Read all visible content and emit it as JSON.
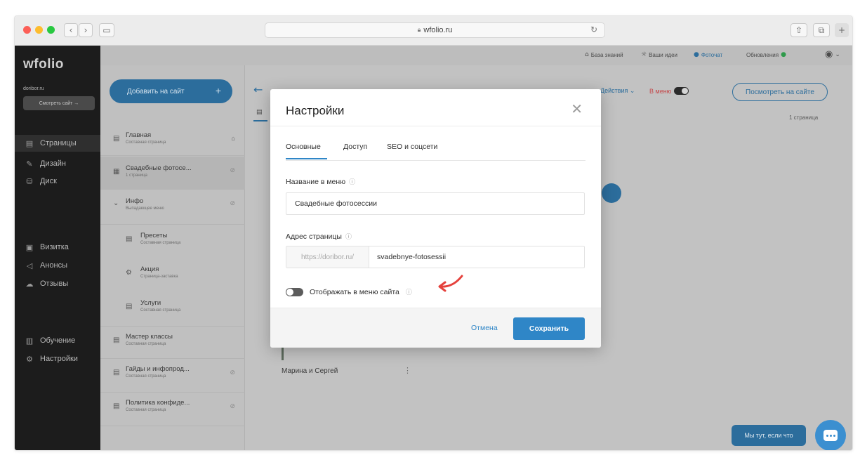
{
  "browser": {
    "url": "wfolio.ru",
    "colors": {
      "close": "#fc5f57",
      "minimize": "#fdbc2e",
      "maximize": "#28c840"
    }
  },
  "app": {
    "logo": "wfolio",
    "site_name": "doribor.ru",
    "visit_site_label": "Смотреть сайт →",
    "sidebar": [
      {
        "label": "Страницы",
        "icon": "page-icon"
      },
      {
        "label": "Дизайн",
        "icon": "brush-icon"
      },
      {
        "label": "Диск",
        "icon": "disk-icon"
      },
      {
        "label": "Визитка",
        "icon": "card-icon"
      },
      {
        "label": "Анонсы",
        "icon": "megaphone-icon"
      },
      {
        "label": "Отзывы",
        "icon": "chat-icon"
      },
      {
        "label": "Обучение",
        "icon": "book-icon"
      },
      {
        "label": "Настройки",
        "icon": "gear-icon"
      }
    ],
    "topbar": {
      "knowledge": "База знаний",
      "ideas": "Ваши идеи",
      "photochat": "Фоточат",
      "updates": "Обновления"
    },
    "add_to_site": "Добавить на сайт",
    "pages": [
      {
        "title": "Главная",
        "subtitle": "Составная страница"
      },
      {
        "title": "Свадебные фотосе...",
        "subtitle": "1 страница"
      },
      {
        "title": "Инфо",
        "subtitle": "Выпадающее меню"
      },
      {
        "title": "Пресеты",
        "subtitle": "Составная страница"
      },
      {
        "title": "Акция",
        "subtitle": "Страница-заставка"
      },
      {
        "title": "Услуги",
        "subtitle": "Составная страница"
      },
      {
        "title": "Мастер классы",
        "subtitle": "Составная страница"
      },
      {
        "title": "Гайды и инфопрод...",
        "subtitle": "Составная страница"
      },
      {
        "title": "Политика конфиде...",
        "subtitle": "Составная страница"
      }
    ],
    "content": {
      "actions_label": "Действия ⌄",
      "in_menu_label": "В меню",
      "view_site_label": "Посмотреть на сайте",
      "pages_count": "1 страница",
      "card_name": "Марина и Сергей"
    },
    "chat": {
      "label": "Мы тут, если что"
    }
  },
  "modal": {
    "title": "Настройки",
    "tabs": [
      "Основные",
      "Доступ",
      "SEO и соцсети"
    ],
    "active_tab": "Основные",
    "menu_name_label": "Название в меню",
    "menu_name_value": "Свадебные фотосессии",
    "address_label": "Адрес страницы",
    "address_prefix": "https://doribor.ru/",
    "address_slug": "svadebnye-fotosessii",
    "show_in_menu_label": "Отображать в меню сайта",
    "show_in_menu": false,
    "cancel_label": "Отмена",
    "save_label": "Сохранить",
    "accent_color": "#2f86c7",
    "arrow_color": "#e5413c"
  }
}
